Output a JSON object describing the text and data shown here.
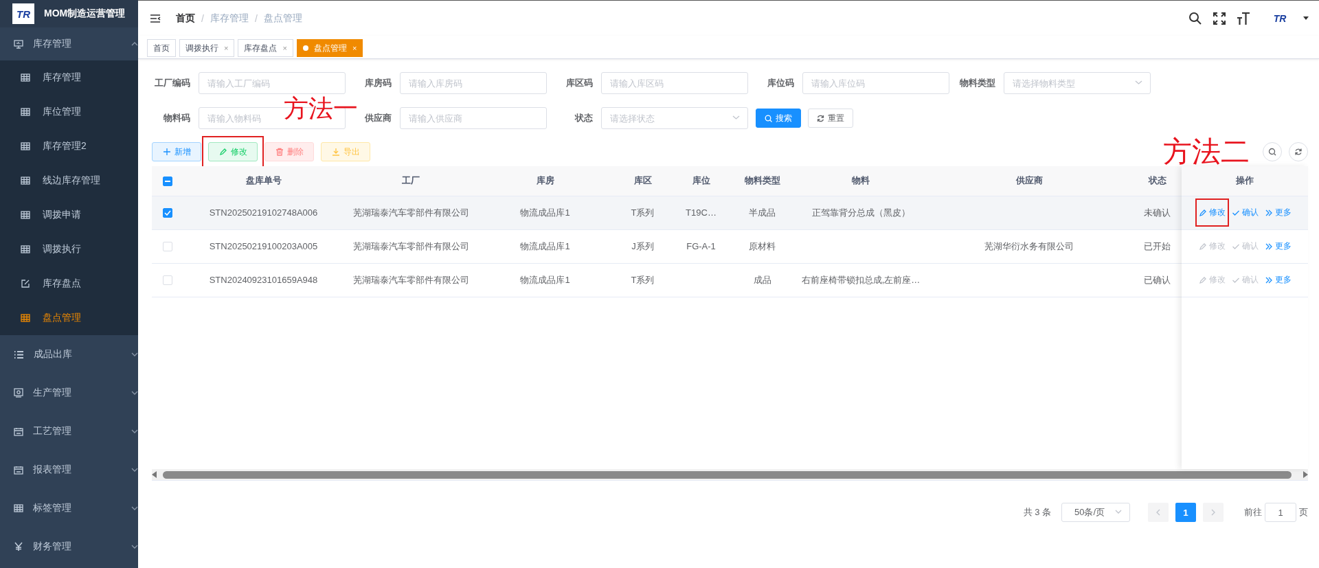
{
  "sidebar": {
    "logo_text": "TR",
    "title": "MOM制造运营管理",
    "groups": [
      {
        "label": "库存管理",
        "expanded": true,
        "children": [
          {
            "label": "库存管理",
            "selected": false
          },
          {
            "label": "库位管理",
            "selected": false
          },
          {
            "label": "库存管理2",
            "selected": false
          },
          {
            "label": "线边库存管理",
            "selected": false
          },
          {
            "label": "调拨申请",
            "selected": false
          },
          {
            "label": "调拨执行",
            "selected": false
          },
          {
            "label": "库存盘点",
            "selected": false
          },
          {
            "label": "盘点管理",
            "selected": true
          }
        ]
      },
      {
        "label": "成品出库",
        "expanded": false
      },
      {
        "label": "生产管理",
        "expanded": false
      },
      {
        "label": "工艺管理",
        "expanded": false
      },
      {
        "label": "报表管理",
        "expanded": false
      },
      {
        "label": "标签管理",
        "expanded": false
      },
      {
        "label": "财务管理",
        "expanded": false
      }
    ]
  },
  "header": {
    "breadcrumb": [
      {
        "label": "首页",
        "is_link": true
      },
      {
        "label": "库存管理",
        "is_link": false
      },
      {
        "label": "盘点管理",
        "is_link": false
      }
    ],
    "separator": "/",
    "avatar_text": "TR"
  },
  "tabs": [
    {
      "label": "首页",
      "selected": false
    },
    {
      "label": "调拨执行",
      "selected": false,
      "close": "×"
    },
    {
      "label": "库存盘点",
      "selected": false,
      "close": "×"
    },
    {
      "label": "盘点管理",
      "selected": true,
      "close": "×"
    }
  ],
  "filters": [
    {
      "label": "工厂编码",
      "placeholder": "请输入工厂编码",
      "kind": "input"
    },
    {
      "label": "库房码",
      "placeholder": "请输入库房码",
      "kind": "input"
    },
    {
      "label": "库区码",
      "placeholder": "请输入库区码",
      "kind": "input"
    },
    {
      "label": "库位码",
      "placeholder": "请输入库位码",
      "kind": "input"
    },
    {
      "label": "物料类型",
      "placeholder": "请选择物料类型",
      "kind": "select"
    },
    {
      "label": "物料码",
      "placeholder": "请输入物料码",
      "kind": "input"
    },
    {
      "label": "供应商",
      "placeholder": "请输入供应商",
      "kind": "input"
    },
    {
      "label": "状态",
      "placeholder": "请选择状态",
      "kind": "select"
    }
  ],
  "filter_buttons": [
    {
      "label": "搜索",
      "kind": "primary"
    },
    {
      "label": "重置",
      "kind": "default"
    }
  ],
  "toolbar": [
    {
      "label": "新增",
      "kind": "add",
      "highlighted": false
    },
    {
      "label": "修改",
      "kind": "edit",
      "highlighted": true
    },
    {
      "label": "删除",
      "kind": "delete",
      "highlighted": false
    },
    {
      "label": "导出",
      "kind": "export",
      "highlighted": false
    }
  ],
  "table": {
    "indeterminate": true,
    "columns": [
      "盘库单号",
      "工厂",
      "库房",
      "库区",
      "库位",
      "物料类型",
      "物料",
      "供应商",
      "状态",
      "操作"
    ],
    "rows": [
      {
        "checked": true,
        "order_no": "STN20250219102748A006",
        "factory": "芜湖瑞泰汽车零部件有限公司",
        "warehouse": "物流成品库1",
        "area": "T系列",
        "location": "T19C…",
        "material_type": "半成品",
        "material": "正驾靠背分总成（黑皮）",
        "status": "未确认",
        "actions": [
          {
            "label": "修改",
            "kind": "edit",
            "disabled": false,
            "highlighted": true
          },
          {
            "label": "确认",
            "kind": "confirm",
            "disabled": false,
            "highlighted": false
          },
          {
            "label": "更多",
            "kind": "more",
            "disabled": false,
            "highlighted": false
          }
        ]
      },
      {
        "checked": false,
        "order_no": "STN20250219100203A005",
        "factory": "芜湖瑞泰汽车零部件有限公司",
        "warehouse": "物流成品库1",
        "area": "J系列",
        "location": "FG-A-1",
        "material_type": "原材料",
        "supplier": "芜湖华衍水务有限公司",
        "status": "已开始",
        "actions": [
          {
            "label": "修改",
            "kind": "edit",
            "disabled": true,
            "highlighted": false
          },
          {
            "label": "确认",
            "kind": "confirm",
            "disabled": true,
            "highlighted": false
          },
          {
            "label": "更多",
            "kind": "more",
            "disabled": false,
            "highlighted": false
          }
        ]
      },
      {
        "checked": false,
        "order_no": "STN20240923101659A948",
        "factory": "芜湖瑞泰汽车零部件有限公司",
        "warehouse": "物流成品库1",
        "area": "T系列",
        "material_type": "成品",
        "material": "右前座椅带锁扣总成,左前座…",
        "status": "已确认",
        "actions": [
          {
            "label": "修改",
            "kind": "edit",
            "disabled": true,
            "highlighted": false
          },
          {
            "label": "确认",
            "kind": "confirm",
            "disabled": true,
            "highlighted": false
          },
          {
            "label": "更多",
            "kind": "more",
            "disabled": false,
            "highlighted": false
          }
        ]
      }
    ]
  },
  "pagination": {
    "total": "共 3 条",
    "page_size": "50条/页",
    "pages": [
      {
        "label": "1",
        "selected": true
      }
    ],
    "goto_label": "前往",
    "goto_value": "1",
    "page_unit": "页"
  },
  "annotations": [
    {
      "text": "方法一"
    },
    {
      "text": "方法二"
    }
  ]
}
